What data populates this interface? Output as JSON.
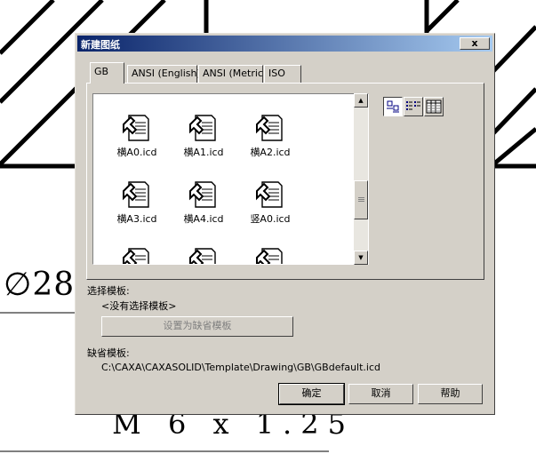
{
  "background": {
    "dimension_text": "∅28",
    "thread_text": "M 6 x 1.25"
  },
  "dialog": {
    "title": "新建图纸",
    "close_label": "x",
    "tabs": [
      {
        "label": "GB",
        "active": true
      },
      {
        "label": "ANSI (English)",
        "active": false
      },
      {
        "label": "ANSI (Metric)",
        "active": false
      },
      {
        "label": "ISO",
        "active": false
      }
    ],
    "templates": [
      {
        "label": "横A0.icd"
      },
      {
        "label": "横A1.icd"
      },
      {
        "label": "横A2.icd"
      },
      {
        "label": "横A3.icd"
      },
      {
        "label": "横A4.icd"
      },
      {
        "label": "竖A0.icd"
      },
      {
        "label": ""
      },
      {
        "label": ""
      },
      {
        "label": ""
      }
    ],
    "view_modes": [
      "large-icons",
      "list",
      "details"
    ],
    "select_template_label": "选择模板:",
    "no_template_selected": "<没有选择模板>",
    "set_default_button": "设置为缺省模板",
    "default_template_label": "缺省模板:",
    "default_template_path": "C:\\CAXA\\CAXASOLID\\Template\\Drawing\\GB\\GBdefault.icd",
    "ok_button": "确定",
    "cancel_button": "取消",
    "help_button": "帮助"
  },
  "colors": {
    "dialog_face": "#d4d0c8",
    "titlebar_start": "#0a246a",
    "titlebar_end": "#a6caf0"
  }
}
